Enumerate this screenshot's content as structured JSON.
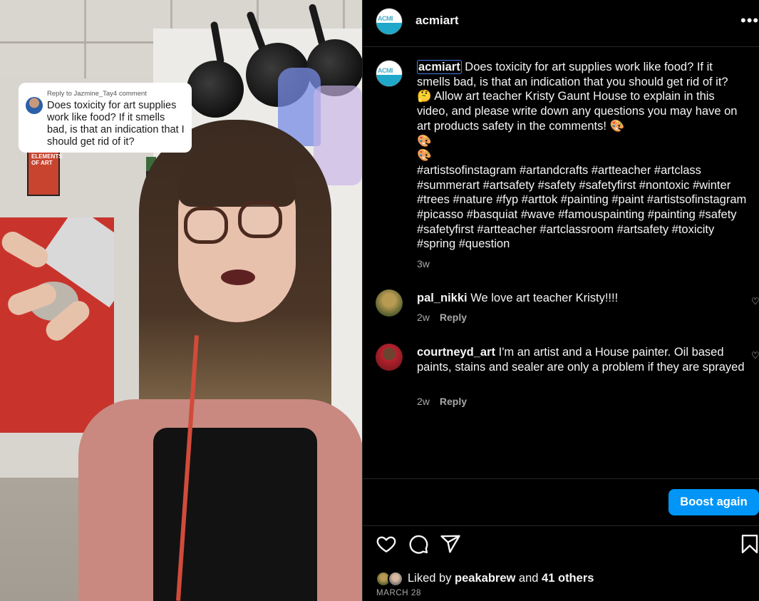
{
  "video": {
    "reply_to": "Reply to Jazmine_Tay4 comment",
    "reply_text": "Does toxicity for art supplies work like food? If it smells bad, is that an indication that I should get rid of it?",
    "poster_text": "ELEMENTS OF ART"
  },
  "header": {
    "username": "acmiart",
    "avatar_text": "ACMI",
    "more_icon": "more-horizontal-icon"
  },
  "caption": {
    "username": "acmiart",
    "text": " Does toxicity for art supplies work like food? If it smells bad, is that an indication that you should get rid of it?",
    "line2": "Allow art teacher Kristy Gaunt House to explain in this video, and please write down any questions you may have on art products safety in the comments! ",
    "emoji_face": "🤔",
    "emoji_palette": "🎨",
    "hashtags": "#artistsofinstagram #artandcrafts #artteacher #artclass #summerart #artsafety #safety #safetyfirst #nontoxic #winter #trees #nature #fyp #arttok #painting #paint #artistsofinstagram #picasso #basquiat #wave #famouspainting #painting #safety #safetyfirst #artteacher #artclassroom #artsafety #toxicity #spring #question",
    "age": "3w"
  },
  "comments": [
    {
      "user": "pal_nikki",
      "text": "We love art teacher Kristy!!!!",
      "age": "2w",
      "reply": "Reply",
      "avatar_color": "#6b6a3a"
    },
    {
      "user": "courtneyd_art",
      "text": "I'm an artist and a House painter. Oil based paints, stains and sealer are only a problem if they are sprayed",
      "age": "2w",
      "reply": "Reply",
      "avatar_color": "#b5222d"
    }
  ],
  "boost_label": "Boost again",
  "likes": {
    "prefix": "Liked by ",
    "user": "peakabrew",
    "middle": " and ",
    "others": "41 others"
  },
  "date": "MARCH 28",
  "icons": [
    "heart-icon",
    "comment-icon",
    "share-icon",
    "bookmark-icon"
  ],
  "colors": {
    "accent": "#0095f6",
    "background": "#000000",
    "text": "#f5f5f5",
    "secondary": "#a8a8a8"
  }
}
